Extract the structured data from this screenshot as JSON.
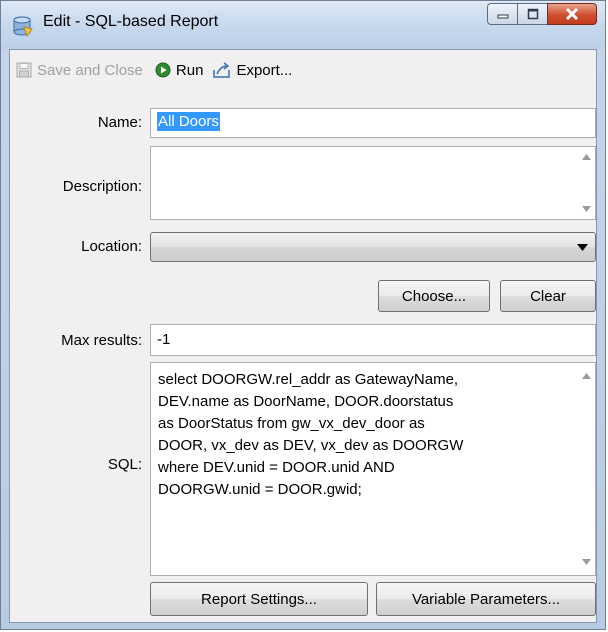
{
  "window": {
    "title": "Edit - SQL-based Report",
    "icon": "database-report-icon",
    "controls": {
      "minimize": "minimize-icon",
      "maximize": "maximize-icon",
      "close": "close-icon"
    }
  },
  "toolbar": {
    "save_close_label": "Save and Close",
    "run_label": "Run",
    "export_label": "Export..."
  },
  "form": {
    "name_label": "Name:",
    "name_value": "All Doors",
    "description_label": "Description:",
    "description_value": "",
    "location_label": "Location:",
    "location_value": "",
    "choose_label": "Choose...",
    "clear_label": "Clear",
    "max_results_label": "Max results:",
    "max_results_value": "-1",
    "sql_label": "SQL:",
    "sql_value": "select DOORGW.rel_addr as GatewayName,\nDEV.name as DoorName, DOOR.doorstatus\nas DoorStatus from gw_vx_dev_door as\nDOOR, vx_dev as DEV, vx_dev as DOORGW\nwhere DEV.unid = DOOR.unid AND\nDOORGW.unid = DOOR.gwid;",
    "report_settings_label": "Report Settings...",
    "variable_parameters_label": "Variable Parameters..."
  },
  "colors": {
    "selection": "#3399ff",
    "run_green": "#2e8b2e",
    "close_red": "#cf4f2f"
  }
}
